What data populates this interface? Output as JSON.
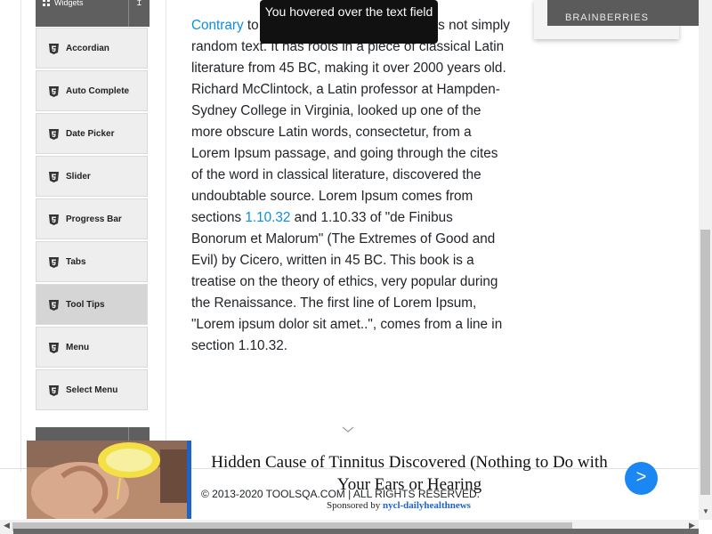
{
  "sidebar": {
    "group_widgets": "Widgets",
    "group_toggle": "↥",
    "items": [
      {
        "label": "Accordian",
        "name": "sidebar-item-accordian"
      },
      {
        "label": "Auto Complete",
        "name": "sidebar-item-auto-complete"
      },
      {
        "label": "Date Picker",
        "name": "sidebar-item-date-picker"
      },
      {
        "label": "Slider",
        "name": "sidebar-item-slider"
      },
      {
        "label": "Progress Bar",
        "name": "sidebar-item-progress-bar"
      },
      {
        "label": "Tabs",
        "name": "sidebar-item-tabs"
      },
      {
        "label": "Tool Tips",
        "name": "sidebar-item-tool-tips",
        "active": true
      },
      {
        "label": "Menu",
        "name": "sidebar-item-menu"
      },
      {
        "label": "Select Menu",
        "name": "sidebar-item-select-menu"
      }
    ]
  },
  "tooltip": {
    "text": "You hovered over the text field"
  },
  "article": {
    "link1": "Contrary",
    "part1": " to popular belief, Lorem Ipsum is not simply random text. It has roots in a piece of classical Latin literature from 45 BC, making it over 2000 years old. Richard McClintock, a Latin professor at Hampden-Sydney College in Virginia, looked up one of the more obscure Latin words, consectetur, from a Lorem Ipsum passage, and going through the cites of the word in classical literature, discovered the undoubtable source. Lorem Ipsum comes from sections ",
    "link2": "1.10.32",
    "part2": " and 1.10.33 of \"de Finibus Bonorum et Malorum\" (The Extremes of Good and Evil) by Cicero, written in 45 BC. This book is a treatise on the theory of ethics, very popular during the Renaissance. The first line of Lorem Ipsum, \"Lorem ipsum dolor sit amet..\", comes from a line in section 1.10.32."
  },
  "right_widget": {
    "label": "BRAINBERRIES"
  },
  "footer": {
    "copyright": "© 2013-2020 TOOLSQA.COM | ALL RIGHTS RESERVED."
  },
  "ad": {
    "headline": "Hidden Cause of Tinnitus Discovered (Nothing to Do with Your Ears or Hearing",
    "sponsor_prefix": "Sponsored by ",
    "sponsor_name": "nycl-dailyhealthnews",
    "next_label": ">"
  },
  "colors": {
    "link": "#0a8fe0",
    "tooltip_bg": "#111111",
    "ad_accent": "#1f63c7",
    "ad_next_button": "#1b87f2",
    "sidebar_header": "#5f5f5f"
  },
  "icons": {
    "group": "grid-icon",
    "menu_item": "html5-icon",
    "collapse": "collapse-icon",
    "scroll_down": "triangle-down-icon",
    "scroll_left": "triangle-left-icon",
    "scroll_right": "triangle-right-icon",
    "page_down": "chevron-down-icon"
  }
}
